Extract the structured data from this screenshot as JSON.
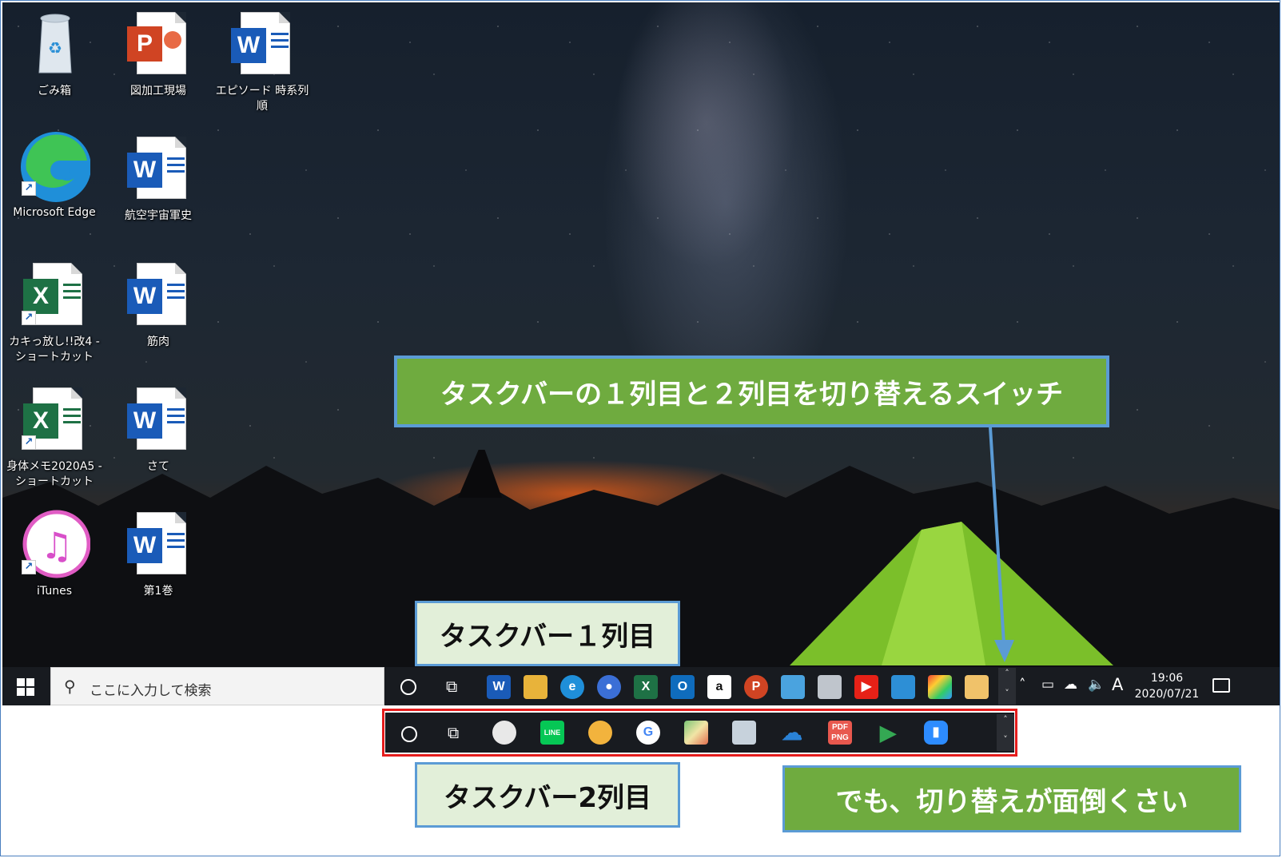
{
  "desktop": {
    "icons": [
      {
        "label": "ごみ箱",
        "type": "recycle-bin"
      },
      {
        "label": "図加工現場",
        "type": "powerpoint"
      },
      {
        "label": "エピソード 時系列順",
        "type": "word"
      },
      {
        "label": "Microsoft Edge",
        "type": "edge"
      },
      {
        "label": "航空宇宙軍史",
        "type": "word"
      },
      {
        "label": "カキっ放し!!改4 - ショートカット",
        "type": "excel"
      },
      {
        "label": "筋肉",
        "type": "word"
      },
      {
        "label": "身体メモ2020A5 - ショートカット",
        "type": "excel"
      },
      {
        "label": "さて",
        "type": "word"
      },
      {
        "label": "iTunes",
        "type": "itunes"
      },
      {
        "label": "第1巻",
        "type": "word"
      }
    ]
  },
  "taskbar1": {
    "search_placeholder": "ここに入力して検索",
    "pinned": [
      "word-icon",
      "file-explorer-icon",
      "edge-icon",
      "people-icon",
      "excel-icon",
      "outlook-icon",
      "amazon-icon",
      "powerpoint-icon",
      "control-panel-icon",
      "scanner-icon",
      "youtube-icon",
      "photos-icon",
      "color-icon",
      "paint-icon"
    ],
    "ime_indicator": "A",
    "clock_time": "19:06",
    "clock_date": "2020/07/21"
  },
  "taskbar2": {
    "pinned": [
      "snipping-icon",
      "line-icon",
      "game-icon",
      "google-icon",
      "map-icon",
      "inbox-icon",
      "onedrive-icon",
      "pdf-png-icon",
      "play-store-icon",
      "zoom-icon"
    ],
    "pdf_label": "PDF PNG",
    "line_label": "LINE"
  },
  "callouts": {
    "switch": "タスクバーの１列目と２列目を切り替えるスイッチ",
    "row1": "タスクバー１列目",
    "row2": "タスクバー2列目",
    "note": "でも、切り替えが面倒くさい"
  },
  "colors": {
    "callout_green": "#6fab3f",
    "callout_light": "#e2efd9",
    "callout_border": "#5b9bd5",
    "highlight_red": "#e51c1c",
    "taskbar": "#181b20"
  }
}
